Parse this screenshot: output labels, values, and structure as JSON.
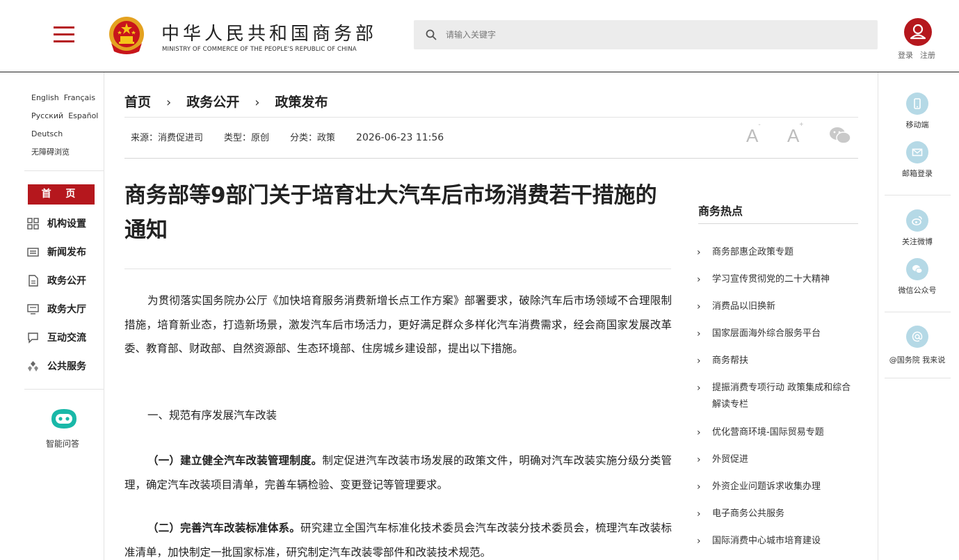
{
  "header": {
    "logo_cn": "中华人民共和国商务部",
    "logo_en": "MINISTRY OF COMMERCE OF THE PEOPLE'S REPUBLIC OF CHINA",
    "search_placeholder": "请输入关键字",
    "login": "登录",
    "register": "注册",
    "brand_color": "#b5171d"
  },
  "sidebar": {
    "languages": [
      "English",
      "Français",
      "Русский",
      "Español",
      "Deutsch"
    ],
    "accessibility": "无障碍浏览",
    "home": "首 页",
    "nav": [
      {
        "label": "机构设置",
        "icon": "grid-icon"
      },
      {
        "label": "新闻发布",
        "icon": "news-icon"
      },
      {
        "label": "政务公开",
        "icon": "document-icon"
      },
      {
        "label": "政务大厅",
        "icon": "monitor-icon"
      },
      {
        "label": "互动交流",
        "icon": "chat-icon"
      },
      {
        "label": "公共服务",
        "icon": "service-icon"
      }
    ],
    "robot_label": "智能问答"
  },
  "breadcrumb": [
    "首页",
    "政务公开",
    "政策发布"
  ],
  "meta": {
    "source": "来源：消费促进司",
    "type": "类型：原创",
    "category": "分类：政策",
    "date": "2026-06-23 11:56"
  },
  "article": {
    "title": "商务部等9部门关于培育壮大汽车后市场消费若干措施的通知",
    "p1": "为贯彻落实国务院办公厅《加快培育服务消费新增长点工作方案》部署要求，破除汽车后市场领域不合理限制措施，培育新业态，打造新场景，激发汽车后市场活力，更好满足群众多样化汽车消费需求，经会商国家发展改革委、教育部、财政部、自然资源部、生态环境部、住房城乡建设部，提出以下措施。",
    "section1": "一、规范有序发展汽车改装",
    "item1_bold": "（一）建立健全汽车改装管理制度。",
    "item1_text": "制定促进汽车改装市场发展的政策文件，明确对汽车改装实施分级分类管理，确定汽车改装项目清单，完善车辆检验、变更登记等管理要求。",
    "item2_bold": "（二）完善汽车改装标准体系。",
    "item2_text": "研究建立全国汽车标准化技术委员会汽车改装分技术委员会，梳理汽车改装标准清单，加快制定一批国家标准，研究制定汽车改装零部件和改装技术规范。"
  },
  "hot": {
    "title": "商务热点",
    "items": [
      "商务部惠企政策专题",
      "学习宣传贯彻党的二十大精神",
      "消费品以旧换新",
      "国家层面海外综合服务平台",
      "商务帮扶",
      "提振消费专项行动 政策集成和综合解读专栏",
      "优化营商环境-国际贸易专题",
      "外贸促进",
      "外资企业问题诉求收集办理",
      "电子商务公共服务",
      "国际消费中心城市培育建设"
    ]
  },
  "rail": {
    "mobile": "移动端",
    "mail": "邮箱登录",
    "weibo": "关注微博",
    "wechat": "微信公众号",
    "state_council": "@国务院 我来说"
  }
}
